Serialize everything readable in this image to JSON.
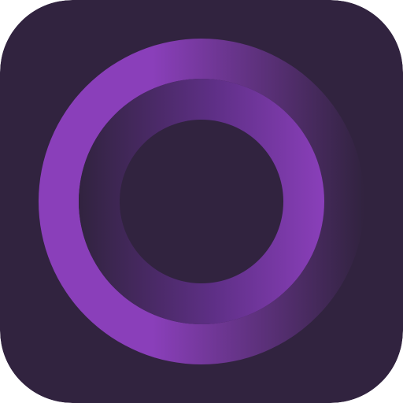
{
  "app_icon": {
    "icon_name": "purple-ring-logo-icon",
    "colors": {
      "background": "#31233F",
      "ring_bright": "#8A3FBA",
      "ring_mid": "#5E2F86",
      "ring_dark": "#31233F"
    }
  }
}
